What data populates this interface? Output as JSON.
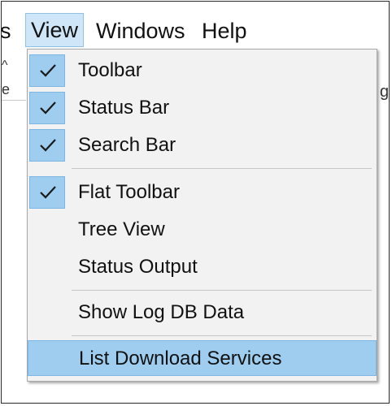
{
  "menubar": {
    "items": [
      {
        "label": "s"
      },
      {
        "label": "View"
      },
      {
        "label": "Windows"
      },
      {
        "label": "Help"
      }
    ]
  },
  "behind": {
    "left_a": "^",
    "left_b": "e",
    "right": "g"
  },
  "view_menu": {
    "items": [
      {
        "label": "Toolbar",
        "checked": true
      },
      {
        "label": "Status Bar",
        "checked": true
      },
      {
        "label": "Search Bar",
        "checked": true
      },
      {
        "label": "Flat Toolbar",
        "checked": true
      },
      {
        "label": "Tree View",
        "checked": false
      },
      {
        "label": "Status Output",
        "checked": false
      },
      {
        "label": "Show Log DB Data",
        "checked": false
      },
      {
        "label": "List Download Services",
        "checked": false,
        "highlighted": true
      }
    ]
  },
  "colors": {
    "check_bg": "#9ecdf0",
    "highlight_bg": "#9ecdf0",
    "menu_bg": "#f2f2f2",
    "menubar_active_bg": "#cfe6f8"
  },
  "icons": {
    "check": "checkmark-icon"
  }
}
